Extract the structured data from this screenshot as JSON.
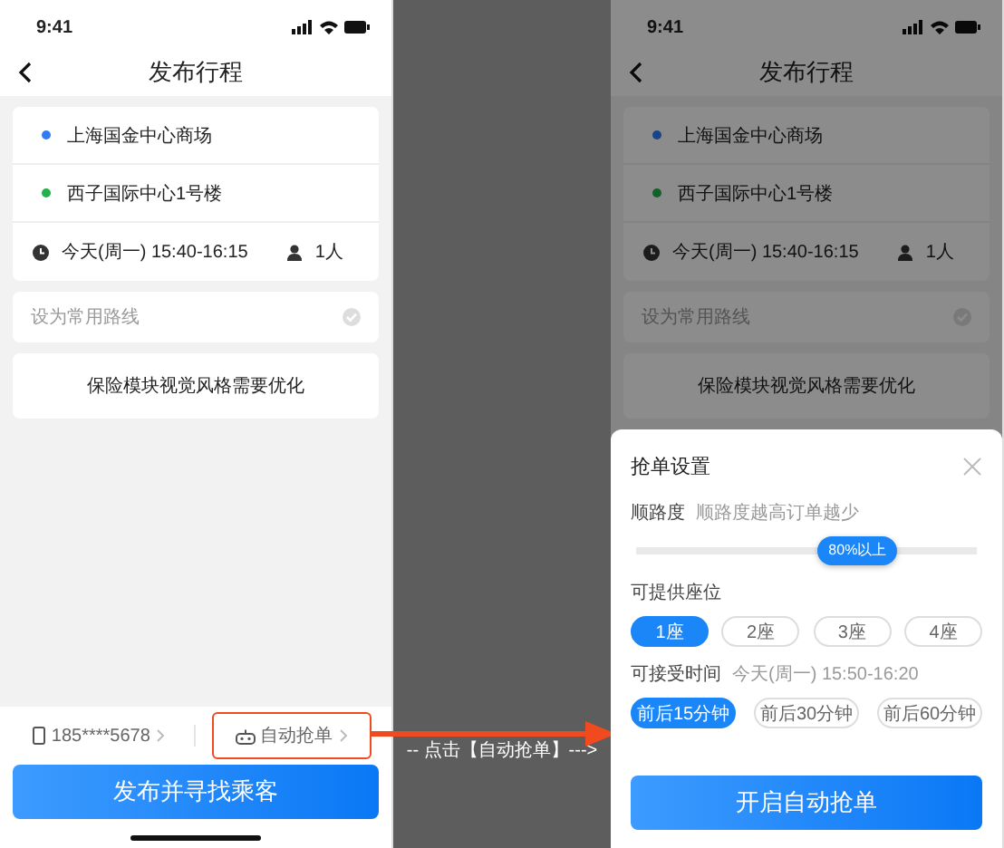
{
  "screens": [
    {
      "status_bar": {
        "time": "9:41"
      },
      "nav": {
        "title": "发布行程"
      },
      "stops": [
        {
          "name": "上海国金中心商场",
          "color": "#2f7cf6"
        },
        {
          "name": "西子国际中心1号楼",
          "color": "#22b14c"
        }
      ],
      "trip": {
        "time": "今天(周一) 15:40-16:15",
        "passengers": "1人"
      },
      "favorite_route": {
        "label": "设为常用路线",
        "checked": false
      },
      "insurance": "保险模块视觉风格需要优化",
      "bottom_bar": {
        "phone": "185****5678",
        "auto_grab": {
          "label": "自动抢单",
          "highlighted": true
        },
        "button": "发布并寻找乘客"
      }
    },
    {
      "status_bar": {
        "time": "9:41"
      },
      "nav": {
        "title": "发布行程"
      },
      "stops": [
        {
          "name": "上海国金中心商场",
          "color": "#1a4487"
        },
        {
          "name": "西子国际中心1号楼",
          "color": "#13612a"
        }
      ],
      "trip": {
        "time": "今天(周一) 15:40-16:15",
        "passengers": "1人"
      },
      "favorite_route": {
        "label": "设为常用路线",
        "checked": false
      },
      "insurance": "保险模块视觉风格需要优化",
      "dimmed": true,
      "sheet": {
        "title": "抢单设置",
        "route_match": {
          "label": "顺路度",
          "hint": "顺路度越高订单越少",
          "level": 0.65,
          "value": "80%以上"
        },
        "seats": {
          "label": "可提供座位",
          "options": [
            {
              "label": "1座",
              "selected": true
            },
            {
              "label": "2座",
              "selected": false
            },
            {
              "label": "3座",
              "selected": false
            },
            {
              "label": "4座",
              "selected": false
            }
          ]
        },
        "time_window": {
          "label": "可接受时间",
          "hint": "今天(周一) 15:50-16:20",
          "options": [
            {
              "label": "前后15分钟",
              "selected": true
            },
            {
              "label": "前后30分钟",
              "selected": false
            },
            {
              "label": "前后60分钟",
              "selected": false
            }
          ]
        },
        "button": "开启自动抢单"
      }
    }
  ],
  "annotation": "-- 点击【自动抢单】--->"
}
